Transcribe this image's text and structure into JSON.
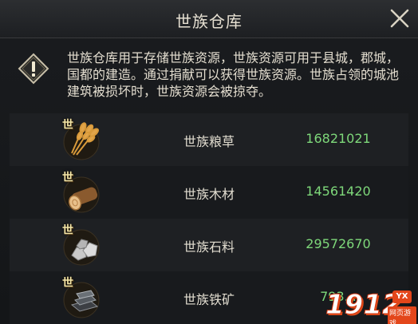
{
  "window": {
    "title": "世族仓库"
  },
  "notice": {
    "text": "世族仓库用于存储世族资源，世族资源可用于县城，郡城，国都的建造。通过捐献可以获得世族资源。世族占领的城池建筑被损坏时，世族资源会被掠夺。"
  },
  "resources": [
    {
      "badge": "世",
      "name": "世族粮草",
      "value": "16821021",
      "icon": "wheat-icon"
    },
    {
      "badge": "世",
      "name": "世族木材",
      "value": "14561420",
      "icon": "log-icon"
    },
    {
      "badge": "世",
      "name": "世族石料",
      "value": "29572670",
      "icon": "stone-icon"
    },
    {
      "badge": "世",
      "name": "世族铁矿",
      "value": "793...",
      "icon": "iron-ingot-icon"
    }
  ],
  "watermark": {
    "number": "1912",
    "tag": "YX",
    "sub": "网页游戏"
  },
  "colors": {
    "value_green": "#7ed87a",
    "title_text": "#e6e0d2",
    "badge_gold": "#f4e6a8"
  }
}
